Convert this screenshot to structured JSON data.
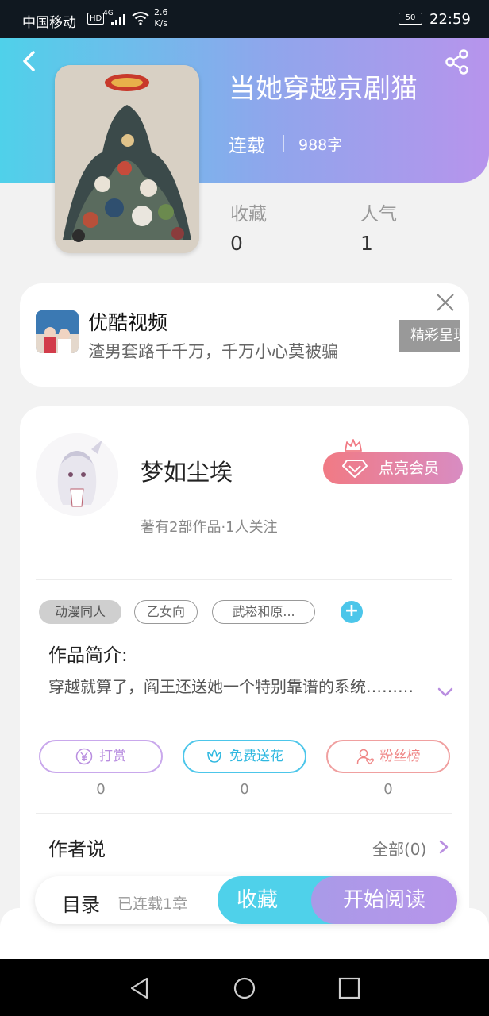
{
  "status_bar": {
    "carrier": "中国移动",
    "hd": "HD",
    "signal_type": "4G",
    "speed_value": "2.6",
    "speed_unit": "K/s",
    "battery": "50",
    "time": "22:59"
  },
  "book": {
    "title": "当她穿越京剧猫",
    "status": "连载",
    "word_count": "988字",
    "stats": [
      {
        "label": "收藏",
        "value": "0"
      },
      {
        "label": "人气",
        "value": "1"
      }
    ]
  },
  "ad": {
    "title": "优酷视频",
    "description": "渣男套路千千万，千万小心莫被骗",
    "badge": "精彩呈现"
  },
  "author": {
    "name": "梦如尘埃",
    "vip_button": "点亮会员",
    "meta": "著有2部作品·1人关注"
  },
  "tags": [
    "动漫同人",
    "乙女向",
    "武崧和原..."
  ],
  "intro": {
    "heading": "作品简介:",
    "text": "穿越就算了，阎王还送她一个特别靠谱的系统………"
  },
  "actions": [
    {
      "label": "打赏",
      "count": "0",
      "color": "#b98ee0"
    },
    {
      "label": "免费送花",
      "count": "0",
      "color": "#4cc6ea"
    },
    {
      "label": "粉丝榜",
      "count": "0",
      "color": "#ef8686"
    }
  ],
  "author_say": {
    "heading": "作者说",
    "all_link": "全部(0)"
  },
  "bottom_bar": {
    "toc": "目录",
    "toc_sub": "已连载1章",
    "favorite": "收藏",
    "start_reading": "开始阅读"
  },
  "colors": {
    "accent_cyan": "#4fd1ea",
    "accent_purple": "#b794ec",
    "vip_pink": "#f17a84"
  }
}
